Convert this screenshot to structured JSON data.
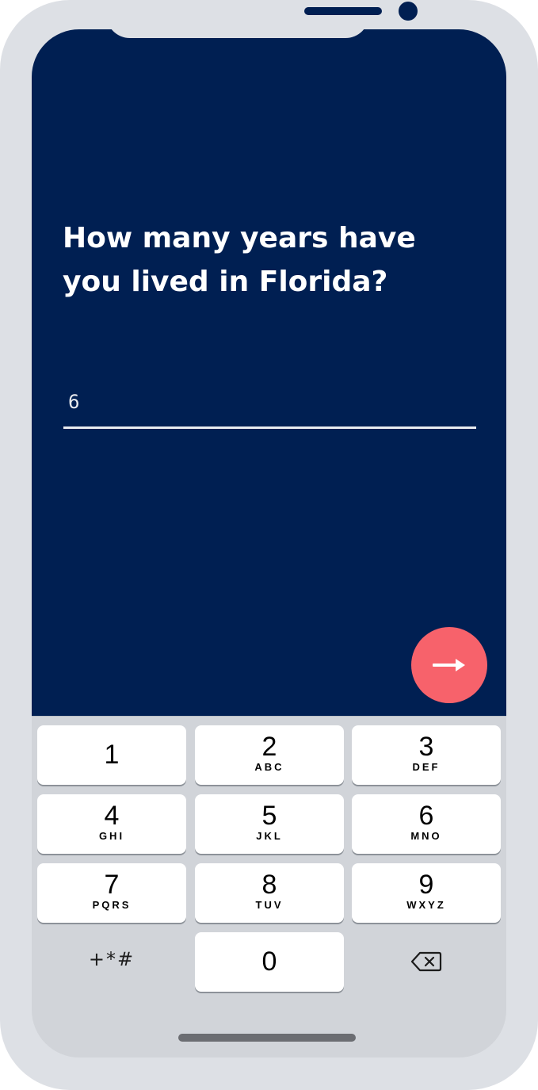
{
  "screen": {
    "question": "How many years have you lived in Florida?",
    "answer_value": "6"
  },
  "next_button": {
    "icon": "arrow-right-icon"
  },
  "keypad": {
    "keys": [
      {
        "digit": "1",
        "letters": ""
      },
      {
        "digit": "2",
        "letters": "ABC"
      },
      {
        "digit": "3",
        "letters": "DEF"
      },
      {
        "digit": "4",
        "letters": "GHI"
      },
      {
        "digit": "5",
        "letters": "JKL"
      },
      {
        "digit": "6",
        "letters": "MNO"
      },
      {
        "digit": "7",
        "letters": "PQRS"
      },
      {
        "digit": "8",
        "letters": "TUV"
      },
      {
        "digit": "9",
        "letters": "WXYZ"
      },
      {
        "digit": "0",
        "letters": ""
      }
    ],
    "symbols_label": "+*#",
    "delete_icon": "backspace-icon"
  },
  "colors": {
    "background": "#001f52",
    "accent": "#f7626b",
    "keyboard": "#d1d4d9",
    "frame": "#dde0e5"
  }
}
